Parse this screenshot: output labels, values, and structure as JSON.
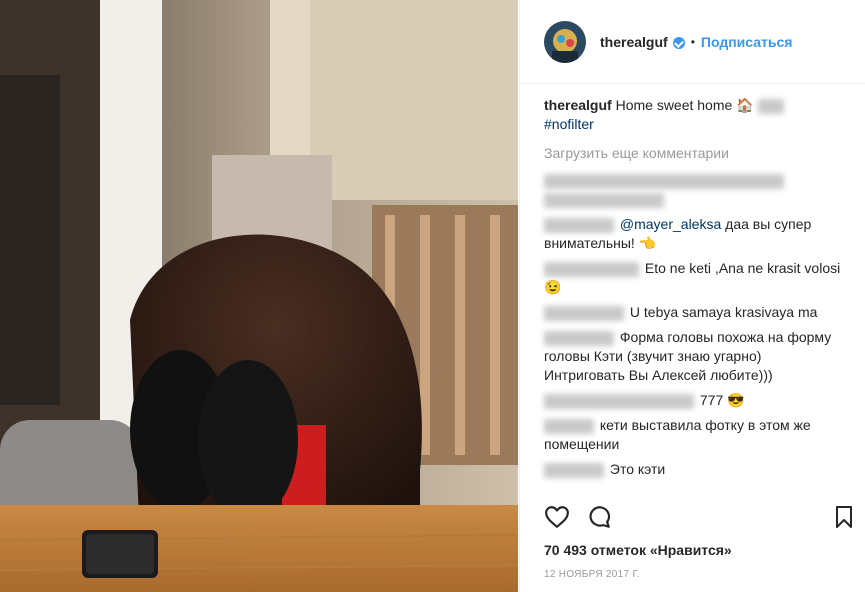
{
  "post": {
    "author": "therealguf",
    "follow_label": "Подписаться",
    "dot": "•",
    "caption_user": "therealguf",
    "caption_text": "Home sweet home 🏠",
    "caption_hashtag": "#nofilter",
    "load_more": "Загрузить еще комментарии",
    "likes": "70 493 отметок «Нравится»",
    "date": "12 НОЯБРЯ 2017 Г."
  },
  "comments": [
    {
      "mention": "@mayer_aleksa",
      "text": " даа вы супер внимательны! 👈"
    },
    {
      "text": "Eto ne keti ,Ana ne krasit volosi😉"
    },
    {
      "text": "U tebya samaya krasivaya ma"
    },
    {
      "text": "Форма головы похожа на форму головы Кэти (звучит знаю угарно) Интриговать Вы Алексей любите)))"
    },
    {
      "text": "777 😎"
    },
    {
      "text": "кети выставила фотку в этом же помещении"
    },
    {
      "text": " Это кэти"
    }
  ],
  "colors": {
    "accent": "#3897f0",
    "hashtag": "#003569",
    "muted": "#999999"
  },
  "icons": [
    "heart-icon",
    "comment-icon",
    "bookmark-icon",
    "verified-badge-icon",
    "house-emoji"
  ]
}
